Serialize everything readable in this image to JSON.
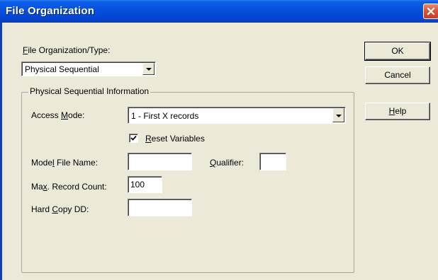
{
  "window": {
    "title": "File Organization"
  },
  "form": {
    "file_org_label": "File Organization/Type:",
    "file_org_value": "Physical Sequential",
    "group_title": "Physical Sequential Information",
    "access_mode_label": "Access Mode:",
    "access_mode_value": "1 - First X records",
    "reset_variables_label": "Reset Variables",
    "reset_variables_checked": true,
    "model_file_label": "Model File Name:",
    "model_file_value": "",
    "qualifier_label": "Qualifier:",
    "qualifier_value": "",
    "max_record_label": "Max. Record Count:",
    "max_record_value": "100",
    "hard_copy_label": "Hard Copy DD:",
    "hard_copy_value": ""
  },
  "buttons": {
    "ok": "OK",
    "cancel": "Cancel",
    "help": "Help"
  },
  "icons": {
    "close": "close-icon",
    "dropdown": "chevron-down-icon",
    "check": "checkmark-icon"
  }
}
